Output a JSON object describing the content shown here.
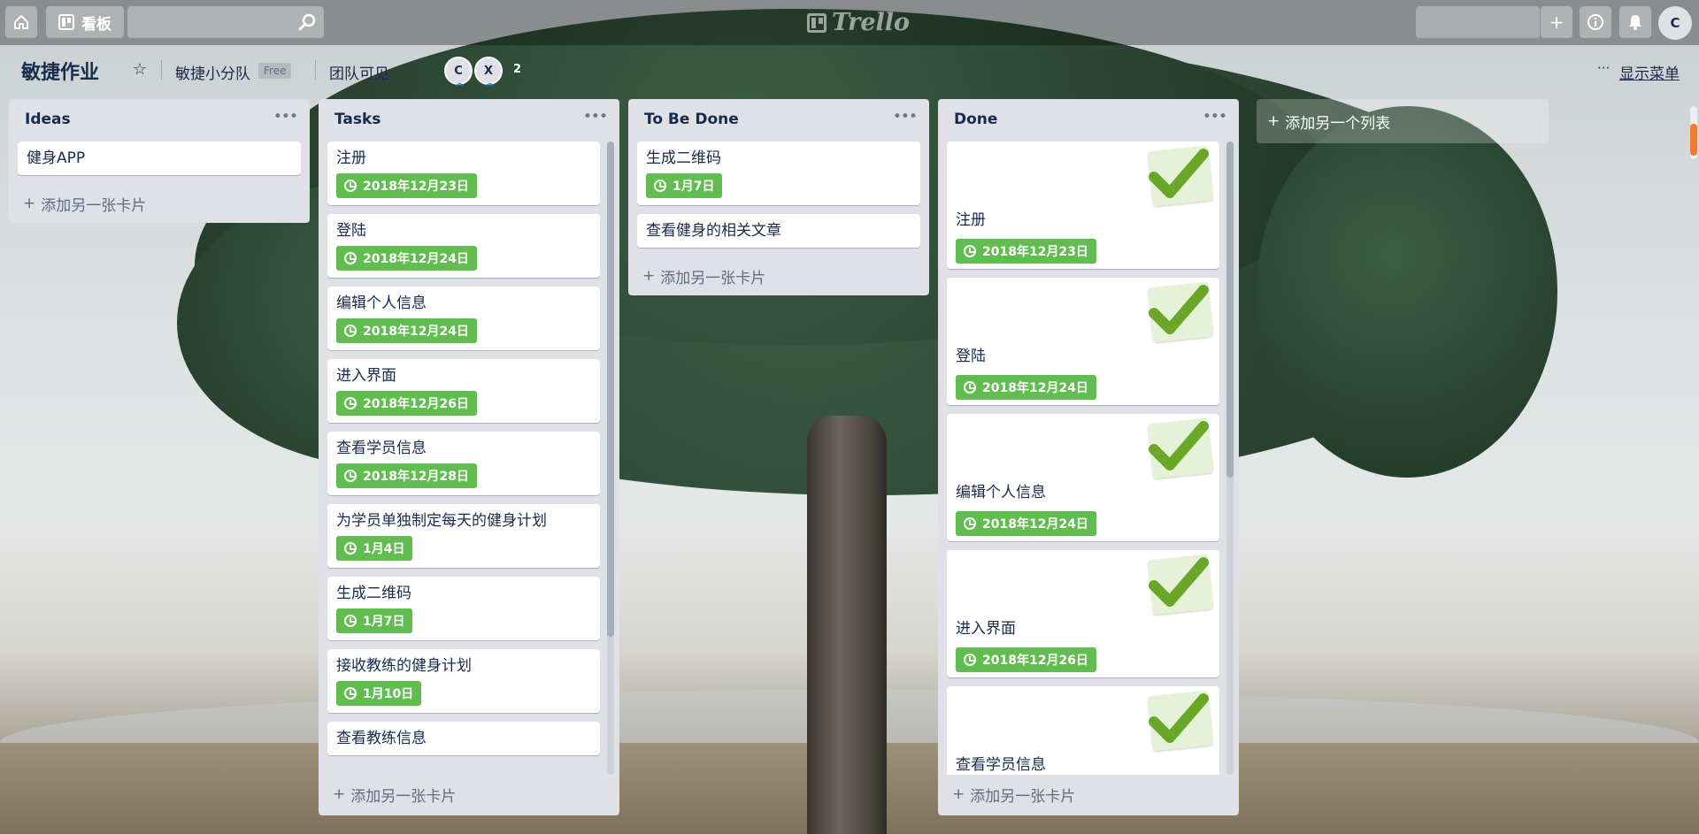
{
  "topbar": {
    "boards_label": "看板",
    "search_placeholder": "",
    "logo_text": "Trello",
    "avatar_initial": "C"
  },
  "board": {
    "title": "敏捷作业",
    "team_name": "敏捷小分队",
    "free_badge": "Free",
    "visibility": "团队可见",
    "members": [
      "C",
      "X"
    ],
    "member_count": "2",
    "menu_dots": "···",
    "show_menu": "显示菜单"
  },
  "lists": [
    {
      "title": "Ideas",
      "cards": [
        {
          "title": "健身APP"
        }
      ],
      "add_card": "添加另一张卡片"
    },
    {
      "title": "Tasks",
      "cards": [
        {
          "title": "注册",
          "due": "2018年12月23日"
        },
        {
          "title": "登陆",
          "due": "2018年12月24日"
        },
        {
          "title": "编辑个人信息",
          "due": "2018年12月24日"
        },
        {
          "title": "进入界面",
          "due": "2018年12月26日"
        },
        {
          "title": "查看学员信息",
          "due": "2018年12月28日"
        },
        {
          "title": "为学员单独制定每天的健身计划",
          "due": "1月4日"
        },
        {
          "title": "生成二维码",
          "due": "1月7日"
        },
        {
          "title": "接收教练的健身计划",
          "due": "1月10日"
        },
        {
          "title": "查看教练信息"
        }
      ],
      "add_card": "添加另一张卡片"
    },
    {
      "title": "To Be Done",
      "cards": [
        {
          "title": "生成二维码",
          "due": "1月7日"
        },
        {
          "title": "查看健身的相关文章"
        }
      ],
      "add_card": "添加另一张卡片"
    },
    {
      "title": "Done",
      "cards": [
        {
          "title": "注册",
          "due": "2018年12月23日"
        },
        {
          "title": "登陆",
          "due": "2018年12月24日"
        },
        {
          "title": "编辑个人信息",
          "due": "2018年12月24日"
        },
        {
          "title": "进入界面",
          "due": "2018年12月26日"
        },
        {
          "title": "查看学员信息"
        }
      ],
      "add_card": "添加另一张卡片"
    }
  ],
  "add_list": "添加另一个列表",
  "colors": {
    "label_green": "#61bd4f",
    "list_bg": "#dfe1e6",
    "text_dark": "#172b4d"
  },
  "icons": [
    "home-icon",
    "boards-icon",
    "search-icon",
    "plus-icon",
    "info-icon",
    "bell-icon",
    "star-icon",
    "clock-icon",
    "check-icon"
  ]
}
